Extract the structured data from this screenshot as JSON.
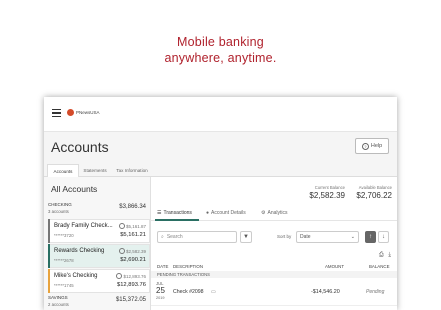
{
  "tagline": {
    "line1": "Mobile banking",
    "line2": "anywhere, anytime."
  },
  "brand": {
    "logo_text": "PNewsUSA"
  },
  "header": {
    "title": "Accounts",
    "help_label": "Help"
  },
  "top_tabs": [
    {
      "label": "Accounts",
      "active": true
    },
    {
      "label": "Statements",
      "active": false
    },
    {
      "label": "Tax Information",
      "active": false
    }
  ],
  "sidebar": {
    "title": "All Accounts",
    "groups": [
      {
        "name": "CHECKING",
        "count": "3 accounts",
        "amount": "$3,866.34"
      },
      {
        "name": "SAVINGS",
        "count": "2 accounts",
        "amount": "$15,372.05"
      }
    ],
    "accounts": [
      {
        "name": "Brady Family Check...",
        "number": "******3720",
        "current": "$5,161.87",
        "balance": "$5,161.21",
        "bar_color": "#777777",
        "selected": false
      },
      {
        "name": "Rewards Checking",
        "number": "******2678",
        "current": "$2,582.39",
        "balance": "$2,690.21",
        "bar_color": "#2a6f63",
        "selected": true
      },
      {
        "name": "Mike's Checking",
        "number": "******1745",
        "current": "$12,893.76",
        "balance": "$12,893.76",
        "bar_color": "#e8a33d",
        "selected": false
      }
    ]
  },
  "balances": {
    "current_label": "Current Balance",
    "current_value": "$2,582.39",
    "available_label": "Available Balance",
    "available_value": "$2,706.22"
  },
  "subtabs": [
    {
      "label": "Transactions",
      "icon": "list-icon",
      "active": true
    },
    {
      "label": "Account Details",
      "icon": "info-icon",
      "active": false
    },
    {
      "label": "Analytics",
      "icon": "analytics-icon",
      "active": false
    }
  ],
  "search": {
    "placeholder": "Search"
  },
  "sort": {
    "label": "Sort by",
    "value": "Date"
  },
  "columns": {
    "date": "DATE",
    "description": "DESCRIPTION",
    "amount": "AMOUNT",
    "balance": "BALANCE"
  },
  "pending_label": "PENDING TRANSACTIONS",
  "transactions": [
    {
      "month": "JUL",
      "day": "25",
      "year": "2019",
      "description": "Check #2098",
      "amount": "-$14,546.20",
      "balance": "Pending"
    }
  ],
  "colors": {
    "accent": "#b0222d",
    "primary": "#2a6f63"
  }
}
